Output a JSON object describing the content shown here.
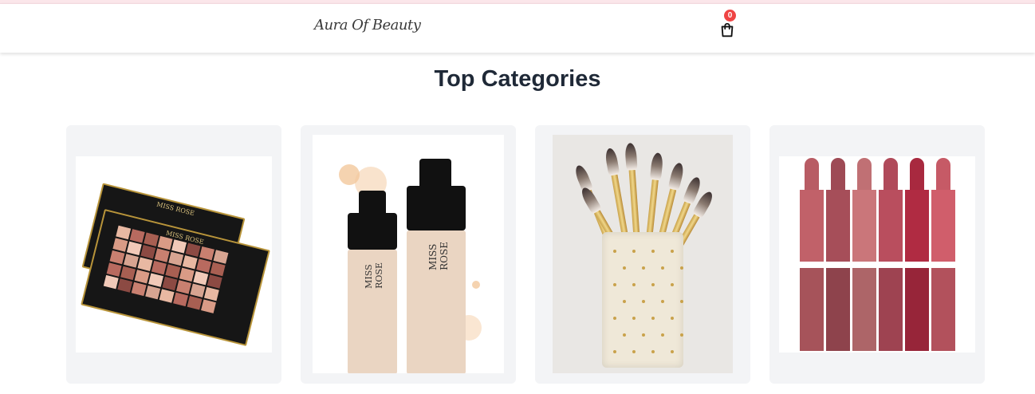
{
  "header": {
    "logo_text": "Aura Of Beauty",
    "cart_count": "0",
    "cart_icon": "shopping-bag-icon"
  },
  "main": {
    "section_title": "Top Categories",
    "categories": [
      {
        "image": "eyeshadow-palette",
        "brand": "MISS ROSE"
      },
      {
        "image": "foundation-bottles",
        "brand": "MISS ROSE"
      },
      {
        "image": "makeup-brushes"
      },
      {
        "image": "lipsticks"
      }
    ]
  },
  "colors": {
    "badge": "#ef4444",
    "card_background": "#f3f4f6",
    "title": "#1f2937"
  }
}
